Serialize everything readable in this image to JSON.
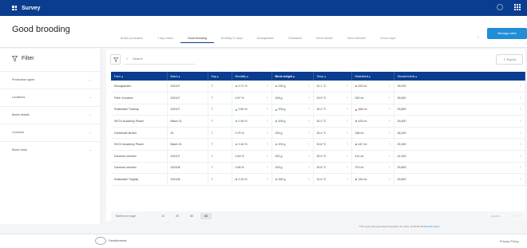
{
  "app": {
    "title": "Survey"
  },
  "page": {
    "title": "Good brooding"
  },
  "tabs": [
    "Broiler production",
    "7 day chicks",
    "Good brooding",
    "Mortality 21 days",
    "Moorgaarden",
    "Rotkaskeli",
    "Demo Broiler",
    "Demo Breeder",
    "Demo Layer"
  ],
  "manage_button": "Manage sites",
  "filter": {
    "title": "Filter",
    "items": [
      "Production types",
      "Locations",
      "Batch details",
      "Columns",
      "Batch rules"
    ]
  },
  "toolbar": {
    "search_placeholder": "Search",
    "export_label": "Export"
  },
  "table": {
    "columns": [
      "Farm",
      "Batch",
      "Day",
      "Mortality",
      "Birds weight",
      "Temp",
      "Waterfeed",
      "Stocked birds"
    ],
    "rows": [
      [
        "Moorgaarden",
        "202107",
        "7",
        "0.71 %",
        "230 g",
        "31.1 °C",
        "433 ml",
        "35,000"
      ],
      [
        "Peter Knudsen",
        "202107",
        "7",
        "0.67 %",
        "208 g",
        "29.5 °C",
        "330 ml",
        "35,600"
      ],
      [
        "Rokkedahl Tinstrup",
        "202107",
        "7",
        "0.60 %",
        "205 g",
        "30.2 °C",
        "466 ml",
        "25,800"
      ],
      [
        "SKOV Academy Peach",
        "Batch 21",
        "7",
        "0.45 %",
        "205 g",
        "30.2 °C",
        "433 ml",
        "25,500"
      ],
      [
        "Grebbinde Broiler",
        "30",
        "7",
        "0.75 %",
        "209 g",
        "32.4 °C",
        "338 ml",
        "36,200"
      ],
      [
        "SKOV Academy Peach",
        "Batch 21",
        "7",
        "0.44 %",
        "203 g",
        "30.8 °C",
        "447 ml",
        "25,300"
      ],
      [
        "Dammen chicken",
        "202107",
        "7",
        "0.63 %",
        "202 g",
        "30.9 °C",
        "414 ml",
        "41,200"
      ],
      [
        "Dammen chicken",
        "202108",
        "7",
        "0.65 %",
        "209 g",
        "30.8 °C",
        "379 ml",
        "33,800"
      ],
      [
        "Rokkedahl Tinghøj",
        "202108",
        "7",
        "0.33 %",
        "260 g",
        "31.6 °C",
        "315 ml",
        "25,800"
      ]
    ],
    "status": {
      "mortality": [
        "g",
        "",
        "g",
        "g",
        "",
        "g",
        "",
        "",
        "r"
      ],
      "weight": [
        "g",
        "",
        "g",
        "g",
        "",
        "g",
        "",
        "",
        "g"
      ],
      "water": [
        "r",
        "",
        "r",
        "r",
        "",
        "r",
        "",
        "",
        "r"
      ]
    }
  },
  "pager": {
    "label": "Batches per page",
    "options": [
      "10",
      "25",
      "50",
      "All"
    ],
    "selected_index": 3,
    "info": "1-9 of 9"
  },
  "generated": {
    "text": "This report was generated November 22, 2021, 11:00:00 AM",
    "link": "Refresh report"
  },
  "footer": {
    "brand": "Farmlinkviewer",
    "privacy": "Privacy Policy"
  }
}
